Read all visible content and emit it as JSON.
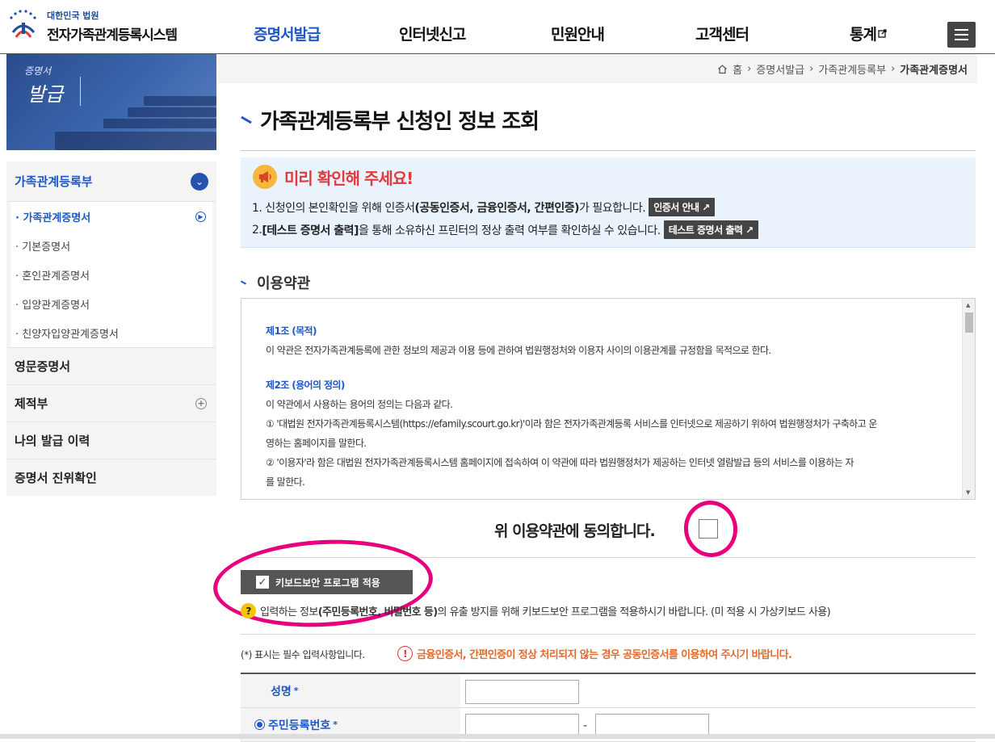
{
  "header": {
    "logo_sub": "대한민국 법원",
    "logo_main": "전자가족관계등록시스템",
    "nav": [
      "증명서발급",
      "인터넷신고",
      "민원안내",
      "고객센터",
      "통계"
    ],
    "active_nav": "증명서발급"
  },
  "side_banner": {
    "line1": "증명서",
    "line2": "발급"
  },
  "lnb": {
    "group": "가족관계등록부",
    "sub_items": [
      "가족관계증명서",
      "기본증명서",
      "혼인관계증명서",
      "입양관계증명서",
      "친양자입양관계증명서"
    ],
    "active_sub": "가족관계증명서",
    "items": [
      "영문증명서",
      "제적부",
      "나의 발급 이력",
      "증명서 진위확인"
    ]
  },
  "breadcrumb": {
    "home": "홈",
    "items": [
      "증명서발급",
      "가족관계등록부"
    ],
    "current": "가족관계증명서"
  },
  "page_title": "가족관계등록부 신청인 정보 조회",
  "notice": {
    "heading": "미리 확인해 주세요!",
    "line1_a": "1. 신청인의 본인확인을 위해 인증서",
    "line1_b": "(공동인증서, 금융인증서, 간편인증)",
    "line1_c": "가 필요합니다.",
    "line1_button": "인증서 안내",
    "line2_a": "2. ",
    "line2_b": "[테스트 증명서 출력]",
    "line2_c": "을 통해 소유하신 프린터의 정상 출력 여부를 확인하실 수 있습니다.",
    "line2_button": "테스트 증명서 출력"
  },
  "terms": {
    "section_title": "이용약관",
    "article1_title": "제1조 (목적)",
    "article1_text": "이 약관은 전자가족관계등록에 관한 정보의 제공과 이용 등에 관하여 법원행정처와 이용자 사이의 이용관계를 규정함을 목적으로 한다.",
    "article2_title": "제2조 (용어의 정의)",
    "article2_text": "이 약관에서 사용하는 용어의 정의는 다음과 같다.",
    "article2_item1": "① '대법원 전자가족관계등록시스템(https://efamily.scourt.go.kr)'이라 함은 전자가족관계등록 서비스를 인터넷으로 제공하기 위하여 법원행정처가 구축하고 운",
    "article2_item1b": "영하는 홈페이지를 말한다.",
    "article2_item2": "② '이용자'라 함은 대법원 전자가족관계등록시스템 홈페이지에 접속하여 이 약관에 따라 법원행정처가 제공하는 인터넷 열람발급 등의 서비스를 이용하는 자",
    "article2_item2b": "를 말한다."
  },
  "agree_label": "위 이용약관에 동의합니다.",
  "keyboard": {
    "button": "키보드보안 프로그램 적용",
    "note_a": "입력하는 정보",
    "note_b": "(주민등록번호, 비밀번호 등)",
    "note_c": "의 유출 방지를 위해 키보드보안 프로그램을 적용하시기 바랍니다. (미 적용 시 가상키보드 사용)"
  },
  "required_note": "(*) 표시는 필수 입력사항입니다.",
  "warning": "금융인증서, 간편인증이 정상 처리되지 않는 경우 공동인증서를 이용하여 주시기 바랍니다.",
  "form": {
    "name_label": "성명",
    "rrn_label": "주민등록번호",
    "star": "*",
    "dash": "-"
  },
  "colors": {
    "primary": "#1e57c6",
    "alert": "#e0393e",
    "warn": "#e46a2b",
    "annotation": "#e6007e"
  }
}
